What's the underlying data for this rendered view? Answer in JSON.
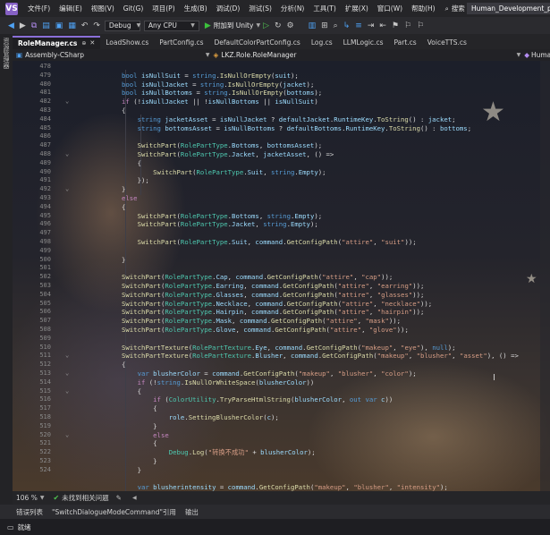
{
  "menu": {
    "logo": "VS",
    "items": [
      "文件(F)",
      "编辑(E)",
      "视图(V)",
      "Git(G)",
      "项目(P)",
      "生成(B)",
      "调试(D)",
      "测试(S)",
      "分析(N)",
      "工具(T)",
      "扩展(X)",
      "窗口(W)",
      "帮助(H)"
    ],
    "search": "搜索",
    "project": "Human_Development_pla"
  },
  "toolbar": {
    "config": "Debug",
    "platform": "Any CPU",
    "run_label": "附加到 Unity"
  },
  "left_strip": {
    "label": "资源管理器"
  },
  "tabs": [
    {
      "label": "RoleManager.cs",
      "active": true
    },
    {
      "label": "LoadShow.cs"
    },
    {
      "label": "PartConfig.cs"
    },
    {
      "label": "DefaultColorPartConfig.cs"
    },
    {
      "label": "Log.cs"
    },
    {
      "label": "LLMLogic.cs"
    },
    {
      "label": "Part.cs"
    },
    {
      "label": "VoiceTTS.cs"
    }
  ],
  "navbar": {
    "assembly": "Assembly-CSharp",
    "class": "LKZ.Role.RoleManager",
    "member": "Human"
  },
  "editor": {
    "line_numbers": [
      "478",
      "479",
      "480",
      "481",
      "482",
      "483",
      "484",
      "485",
      "486",
      "487",
      "488",
      "489",
      "490",
      "491",
      "492",
      "493",
      "494",
      "495",
      "496",
      "497",
      "498",
      "499",
      "500",
      "501",
      "502",
      "503",
      "504",
      "505",
      "506",
      "507",
      "508",
      "509",
      "510",
      "511",
      "512",
      "513",
      "514",
      "515",
      "516",
      "517",
      "518",
      "519",
      "520",
      "521",
      "522",
      "523",
      "524"
    ],
    "fold_lines": [
      "482",
      "488",
      "492",
      "511",
      "513",
      "515",
      "520"
    ]
  },
  "editor_bar": {
    "zoom": "106 %",
    "issues": "未找到相关问题"
  },
  "output_tabs": [
    "错误列表",
    "\"SwitchDialogueModeCommand\"引用",
    "输出"
  ],
  "status": {
    "text": "就绪"
  },
  "colors": {
    "accent": "#8a6fd8",
    "keyword": "#569cd6",
    "type": "#4ec9b0",
    "string": "#d69d85",
    "method": "#dcdcaa"
  }
}
